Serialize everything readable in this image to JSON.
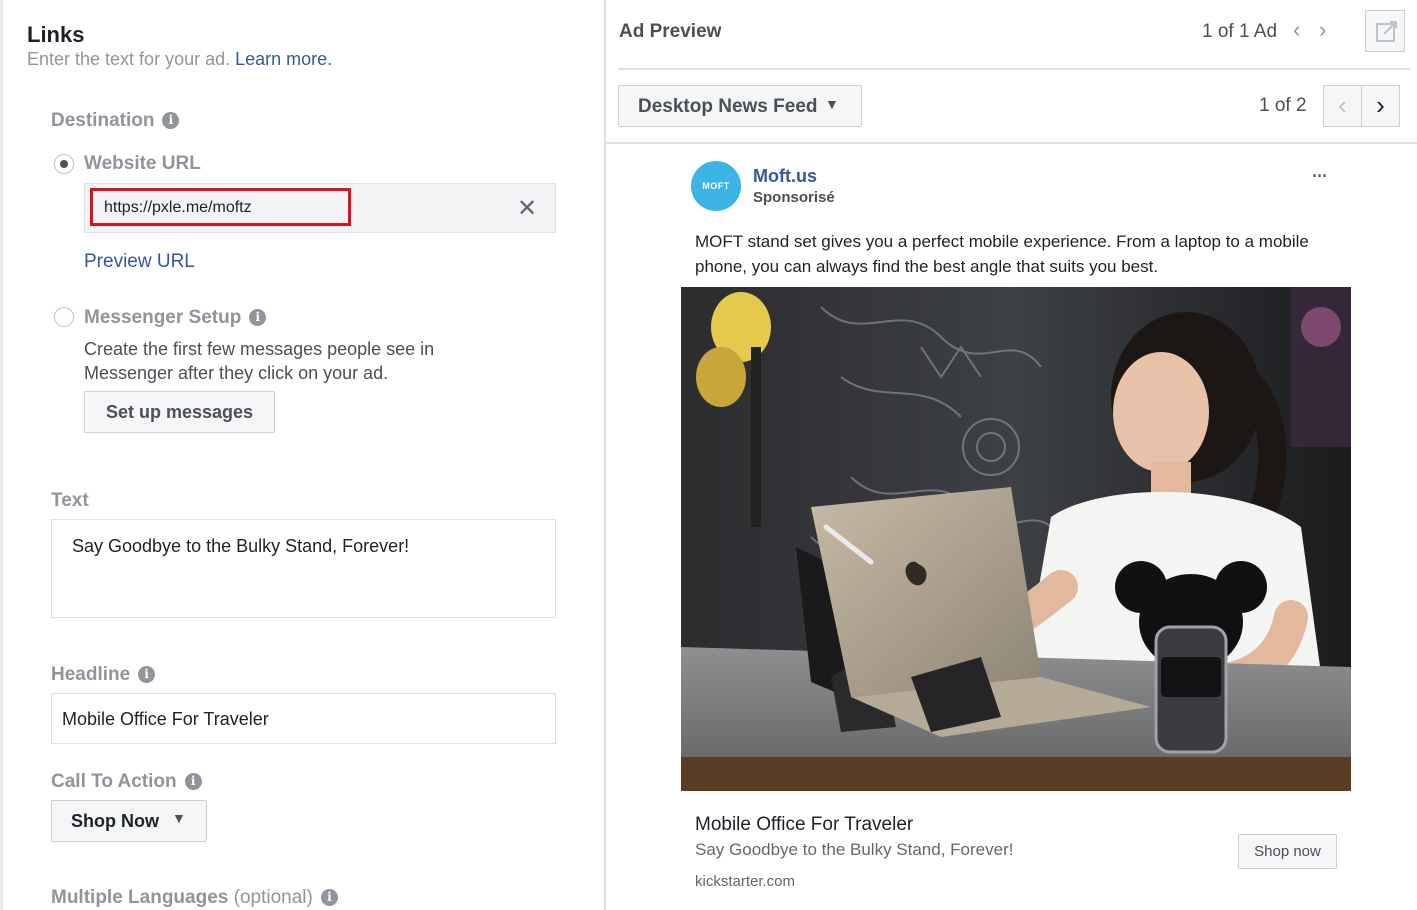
{
  "links": {
    "title": "Links",
    "subtitle": "Enter the text for your ad.",
    "learn_more": "Learn more.",
    "destination_label": "Destination",
    "website_url_label": "Website URL",
    "website_url_value": "https://pxle.me/moftz",
    "preview_url": "Preview URL",
    "messenger_label": "Messenger Setup",
    "messenger_desc_1": "Create the first few messages people see in",
    "messenger_desc_2": "Messenger after they click on your ad.",
    "setup_messages_btn": "Set up messages",
    "text_label": "Text",
    "text_value": "Say Goodbye to the Bulky Stand, Forever!",
    "headline_label": "Headline",
    "headline_value": "Mobile Office For Traveler",
    "cta_label": "Call To Action",
    "cta_value": "Shop Now",
    "multi_lang_label": "Multiple Languages",
    "multi_lang_optional": "(optional)"
  },
  "preview": {
    "title": "Ad Preview",
    "ad_count": "1 of 1 Ad",
    "placement": "Desktop News Feed",
    "placement_count": "1 of 2",
    "page_name": "Moft.us",
    "sponsored": "Sponsorisé",
    "logo_text": "MOFT",
    "body_1": "MOFT stand set gives you a perfect mobile experience. From a laptop to a mobile",
    "body_2": "phone, you can always find the best angle that suits you best.",
    "headline": "Mobile Office For Traveler",
    "description": "Say Goodbye to the Bulky Stand, Forever!",
    "domain": "kickstarter.com",
    "cta_button": "Shop now",
    "more_icon": "···"
  },
  "colors": {
    "link": "#365899",
    "label_gray": "#90949c",
    "highlight_red": "#e0101a",
    "logo_blue": "#3cb4e5"
  }
}
